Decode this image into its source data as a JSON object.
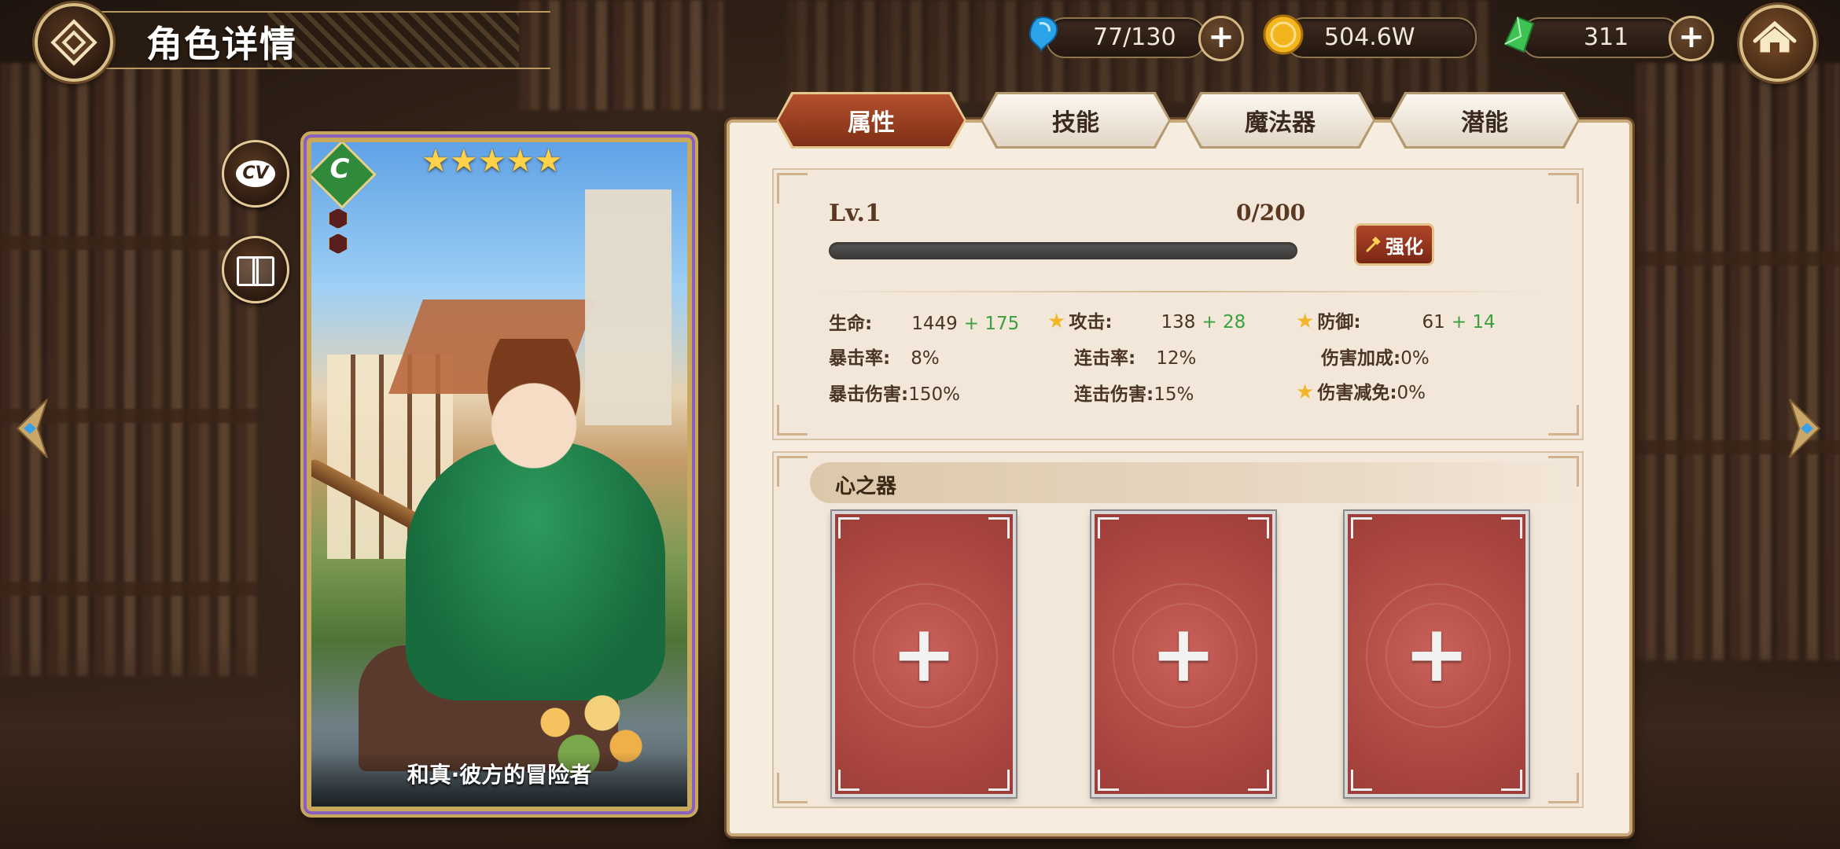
{
  "header": {
    "title": "角色详情"
  },
  "resources": [
    {
      "name": "stamina",
      "icon": "blue-crystal-icon",
      "value": "77/130",
      "has_plus": true
    },
    {
      "name": "gold",
      "icon": "gold-coin-icon",
      "value": "504.6W",
      "has_plus": false
    },
    {
      "name": "gem",
      "icon": "green-crystal-icon",
      "value": "311",
      "has_plus": true
    }
  ],
  "side_buttons": {
    "cv_label": "CV"
  },
  "card": {
    "name": "和真·彼方的冒险者",
    "rarity_letter": "C",
    "stars": "★★★★★",
    "star_count": 5
  },
  "tabs": [
    {
      "label": "属性",
      "active": true
    },
    {
      "label": "技能",
      "active": false
    },
    {
      "label": "魔法器",
      "active": false
    },
    {
      "label": "潜能",
      "active": false
    }
  ],
  "level": {
    "label": "Lv.1",
    "exp": "0/200",
    "progress_fraction": 0.0,
    "enhance_label": "强化"
  },
  "stats": {
    "hp_label": "生命:",
    "hp_value": "1449",
    "hp_bonus": "+ 175",
    "atk_label": "攻击:",
    "atk_value": "138",
    "atk_bonus": "+ 28",
    "def_label": "防御:",
    "def_value": "61",
    "def_bonus": "+ 14",
    "crit_rate_label": "暴击率:",
    "crit_rate_value": "8%",
    "combo_rate_label": "连击率:",
    "combo_rate_value": "12%",
    "dmg_bonus_label": "伤害加成:",
    "dmg_bonus_value": "0%",
    "crit_dmg_label": "暴击伤害:",
    "crit_dmg_value": "150%",
    "combo_dmg_label": "连击伤害:",
    "combo_dmg_value": "15%",
    "dmg_reduce_label": "伤害减免:",
    "dmg_reduce_value": "0%"
  },
  "heart_vessel": {
    "title": "心之器",
    "slots": [
      "+",
      "+",
      "+"
    ]
  },
  "colors": {
    "tab_active": "#9a3f20",
    "panel_bg": "#f6ece0",
    "bonus_green": "#3aa040",
    "slot_red": "#b44d46",
    "gold_border": "#c8a85a"
  }
}
